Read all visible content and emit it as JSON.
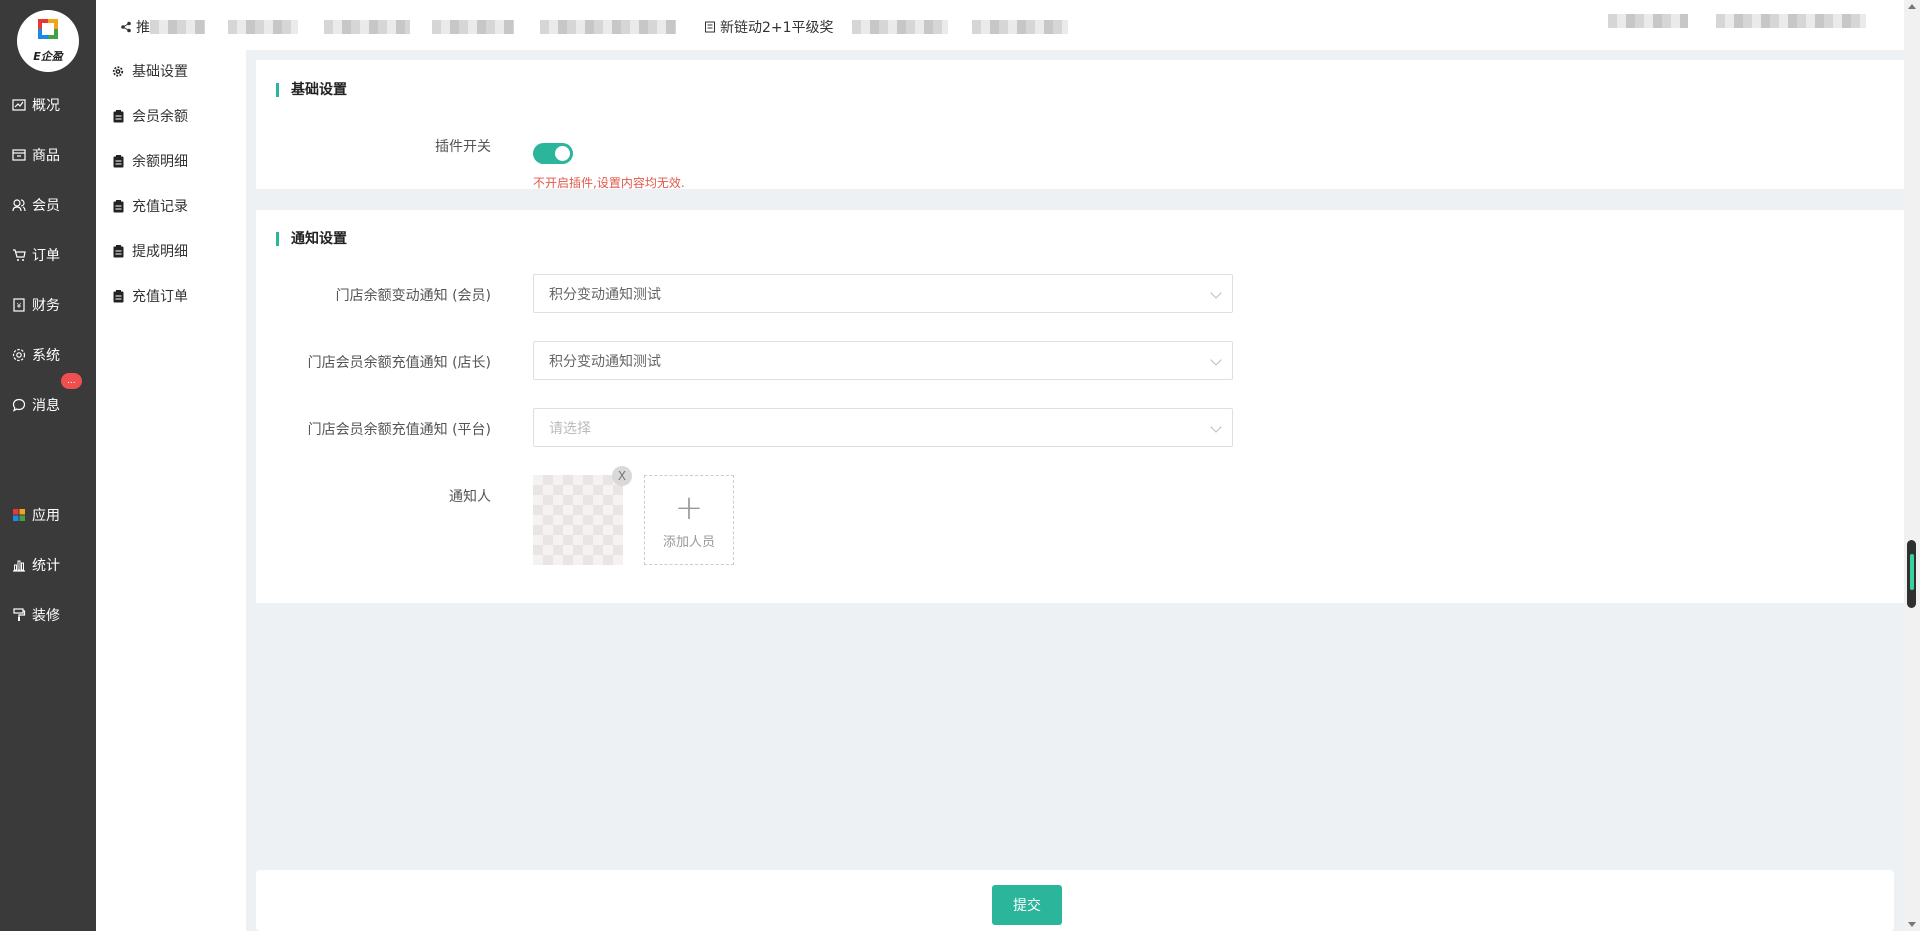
{
  "brand": {
    "logo_text": "E企盈"
  },
  "colors": {
    "accent": "#2bb59b",
    "sidebar_bg": "#3a3a3a",
    "hint": "#e05a4a"
  },
  "sidebar": {
    "items": [
      {
        "label": "概况",
        "icon": "chart-icon"
      },
      {
        "label": "商品",
        "icon": "goods-icon"
      },
      {
        "label": "会员",
        "icon": "member-icon"
      },
      {
        "label": "订单",
        "icon": "cart-icon"
      },
      {
        "label": "财务",
        "icon": "finance-icon"
      },
      {
        "label": "系统",
        "icon": "gear-icon"
      },
      {
        "label": "消息",
        "icon": "message-icon",
        "badge": "..."
      },
      {
        "label": "应用",
        "icon": "apps-icon"
      },
      {
        "label": "统计",
        "icon": "stats-icon"
      },
      {
        "label": "装修",
        "icon": "paint-roller-icon"
      }
    ]
  },
  "subnav": {
    "items": [
      {
        "label": "基础设置",
        "icon": "gear-icon"
      },
      {
        "label": "会员余额",
        "icon": "clipboard-icon"
      },
      {
        "label": "余额明细",
        "icon": "clipboard-icon"
      },
      {
        "label": "充值记录",
        "icon": "clipboard-icon"
      },
      {
        "label": "提成明细",
        "icon": "clipboard-icon"
      },
      {
        "label": "充值订单",
        "icon": "clipboard-icon"
      }
    ]
  },
  "topbar": {
    "items": [
      {
        "label": "推",
        "icon": "share-icon"
      },
      {
        "label": "新链动2+1平级奖",
        "icon": "document-icon"
      }
    ]
  },
  "basic": {
    "title": "基础设置",
    "plugin_switch_label": "插件开关",
    "plugin_switch_on": true,
    "plugin_hint": "不开启插件,设置内容均无效."
  },
  "notify": {
    "title": "通知设置",
    "fields": [
      {
        "label": "门店余额变动通知 (会员)",
        "value": "积分变动通知测试"
      },
      {
        "label": "门店会员余额充值通知 (店长)",
        "value": "积分变动通知测试"
      },
      {
        "label": "门店会员余额充值通知 (平台)",
        "value": "",
        "placeholder": "请选择"
      }
    ],
    "notifier_label": "通知人",
    "remove_label": "X",
    "add_label": "添加人员"
  },
  "footer": {
    "submit_label": "提交"
  }
}
